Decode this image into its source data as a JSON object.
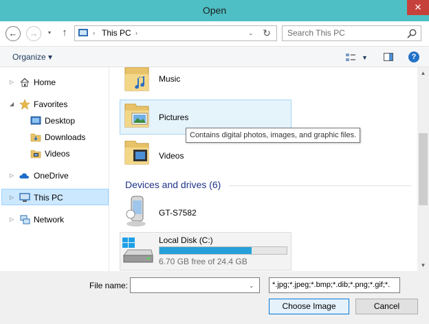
{
  "window": {
    "title": "Open",
    "close_glyph": "✕"
  },
  "nav": {
    "back_glyph": "←",
    "forward_glyph": "→",
    "recent_glyph": "▾",
    "up_glyph": "↑",
    "address": {
      "location": "This PC",
      "sep": "›",
      "dropdown": "⌄",
      "refresh_glyph": "↻"
    },
    "search": {
      "placeholder": "Search This PC"
    }
  },
  "commandbar": {
    "organize": "Organize ▾",
    "views_dd": "▼",
    "help": "?"
  },
  "sidebar": {
    "items": [
      {
        "label": "Home",
        "arrow": "▷",
        "icon": "home-icon"
      },
      {
        "label": "Favorites",
        "arrow": "◢",
        "icon": "star-icon"
      },
      {
        "label": "Desktop",
        "icon": "desktop-icon"
      },
      {
        "label": "Downloads",
        "icon": "downloads-folder-icon"
      },
      {
        "label": "Videos",
        "icon": "videos-folder-icon"
      },
      {
        "label": "OneDrive",
        "arrow": "▷",
        "icon": "cloud-icon"
      },
      {
        "label": "This PC",
        "arrow": "▷",
        "icon": "computer-icon"
      },
      {
        "label": "Network",
        "arrow": "▷",
        "icon": "network-icon"
      }
    ]
  },
  "content": {
    "folders": [
      {
        "label": "Music",
        "icon": "music-folder-icon"
      },
      {
        "label": "Pictures",
        "icon": "pictures-folder-icon"
      },
      {
        "label": "Videos",
        "icon": "videos-folder-icon"
      }
    ],
    "devices_header": "Devices and drives (6)",
    "devices": [
      {
        "label": "GT-S7582",
        "icon": "phone-icon"
      },
      {
        "label": "Local Disk (C:)",
        "icon": "disk-icon",
        "free_text": "6.70 GB free of 24.4 GB",
        "used_fraction": 0.725
      }
    ],
    "tooltip": "Contains digital photos, images, and graphic files."
  },
  "scrollbar": {
    "up": "▲",
    "down": "▼"
  },
  "footer": {
    "filename_label": "File name:",
    "filename_value": "",
    "dropdown_glyph": "⌄",
    "filter": "*.jpg;*.jpeg;*.bmp;*.dib;*.png;*.gif;*.",
    "choose_label": "Choose Image",
    "cancel_label": "Cancel"
  },
  "colors": {
    "titlebar": "#4ebfc4",
    "close": "#c7413b",
    "selection": "#cce8ff",
    "progress": "#26a0da",
    "section_header": "#1e3287"
  }
}
